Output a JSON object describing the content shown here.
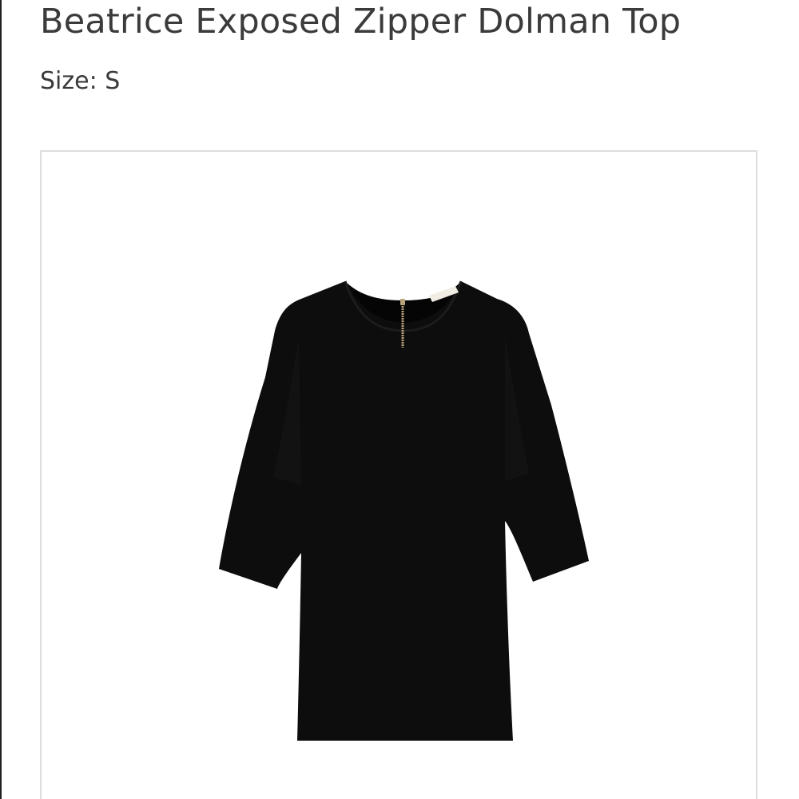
{
  "product": {
    "title": "Beatrice Exposed Zipper Dolman Top",
    "size_label": "Size:",
    "size_value": "S"
  },
  "image": {
    "subject": "garment-photo",
    "garment_color": "#0d0d0d",
    "zipper_color": "#b9a47a"
  }
}
